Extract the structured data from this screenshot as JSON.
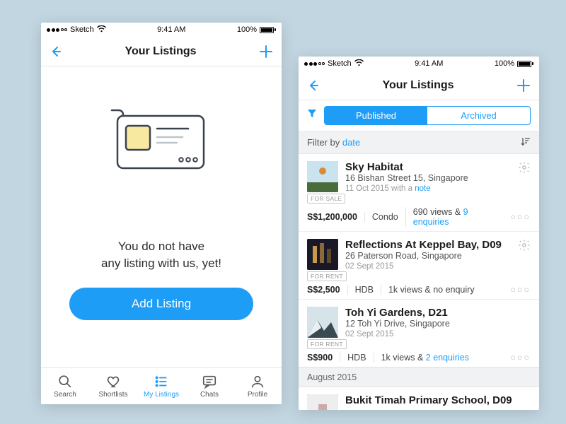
{
  "status": {
    "carrier": "Sketch",
    "time": "9:41 AM",
    "battery": "100%"
  },
  "nav": {
    "title": "Your Listings"
  },
  "empty": {
    "line1": "You do not have",
    "line2": "any listing with us, yet!",
    "cta": "Add Listing"
  },
  "tabs": {
    "search": "Search",
    "shortlists": "Shortlists",
    "mylistings": "My Listings",
    "chats": "Chats",
    "profile": "Profile"
  },
  "seg": {
    "published": "Published",
    "archived": "Archived"
  },
  "filter": {
    "prefix": "Filter by ",
    "by": "date"
  },
  "listings": [
    {
      "name": "Sky Habitat",
      "addr": "16 Bishan Street 15, Singapore",
      "date": "11 Oct 2015 with a ",
      "note": "note",
      "badge": "FOR SALE",
      "price": "S$1,200,000",
      "type": "Condo",
      "stats_pre": "690 views & ",
      "stats_enq": "9 enquiries"
    },
    {
      "name": "Reflections At Keppel Bay, D09",
      "addr": "26 Paterson Road, Singapore",
      "date": "02 Sept 2015",
      "note": "",
      "badge": "FOR RENT",
      "price": "S$2,500",
      "type": "HDB",
      "stats_pre": "1k views & no enquiry",
      "stats_enq": ""
    },
    {
      "name": "Toh Yi Gardens, D21",
      "addr": "12 Toh Yi Drive, Singapore",
      "date": "02 Sept 2015",
      "note": "",
      "badge": "FOR RENT",
      "price": "S$900",
      "type": "HDB",
      "stats_pre": "1k views & ",
      "stats_enq": "2 enquiries"
    }
  ],
  "section_header": "August 2015",
  "last": {
    "name": "Bukit Timah Primary School, D09"
  }
}
